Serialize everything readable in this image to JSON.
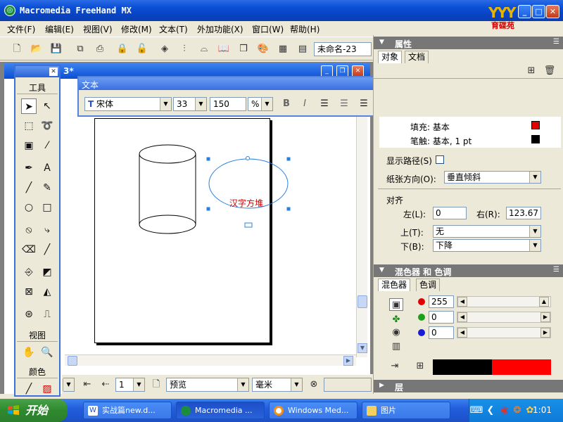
{
  "window": {
    "title": "Macromedia FreeHand MX",
    "logo_text": "育碟苑"
  },
  "menu": [
    "文件(F)",
    "编辑(E)",
    "视图(V)",
    "修改(M)",
    "文本(T)",
    "外加功能(X)",
    "窗口(W)",
    "帮助(H)"
  ],
  "toolbar": {
    "document_name": "未命名-23"
  },
  "document": {
    "title_suffix": "3*",
    "sample_text": "汉字方堆"
  },
  "tools_panel": {
    "tools_label": "工具",
    "view_label": "视图",
    "color_label": "颜色"
  },
  "text_panel": {
    "title": "文本",
    "font": "宋体",
    "font_size": "33",
    "scale_value": "150",
    "scale_unit": "%"
  },
  "status_bar": {
    "page_value": "1",
    "preview": "预览",
    "unit": "毫米"
  },
  "properties_panel": {
    "title": "属性",
    "tabs": [
      "对象",
      "文档"
    ],
    "fill_label": "填充: 基本",
    "stroke_label": "笔触: 基本, 1 pt",
    "fill_color": "#e00000",
    "stroke_color": "#000000",
    "show_path_label": "显示路径(S)",
    "orientation_label": "纸张方向(O):",
    "orientation_value": "垂直倾斜",
    "alignment_label": "对齐",
    "left_label": "左(L):",
    "left_value": "0",
    "right_label": "右(R):",
    "right_value": "123.67",
    "top_label": "上(T):",
    "top_value": "无",
    "bottom_label": "下(B):",
    "bottom_value": "下降"
  },
  "mixer_panel": {
    "title": "混色器 和 色调",
    "tabs": [
      "混色器",
      "色调"
    ],
    "red_value": "255",
    "green_value": "0",
    "blue_value": "0",
    "preview_left_color": "#000000",
    "preview_right_color": "#ff0000"
  },
  "layers_panel": {
    "title": "层"
  },
  "taskbar": {
    "start_label": "开始",
    "tasks": [
      "实战篇new.d...",
      "Macromedia ...",
      "Windows Med...",
      "图片"
    ],
    "clock": "1:01"
  }
}
